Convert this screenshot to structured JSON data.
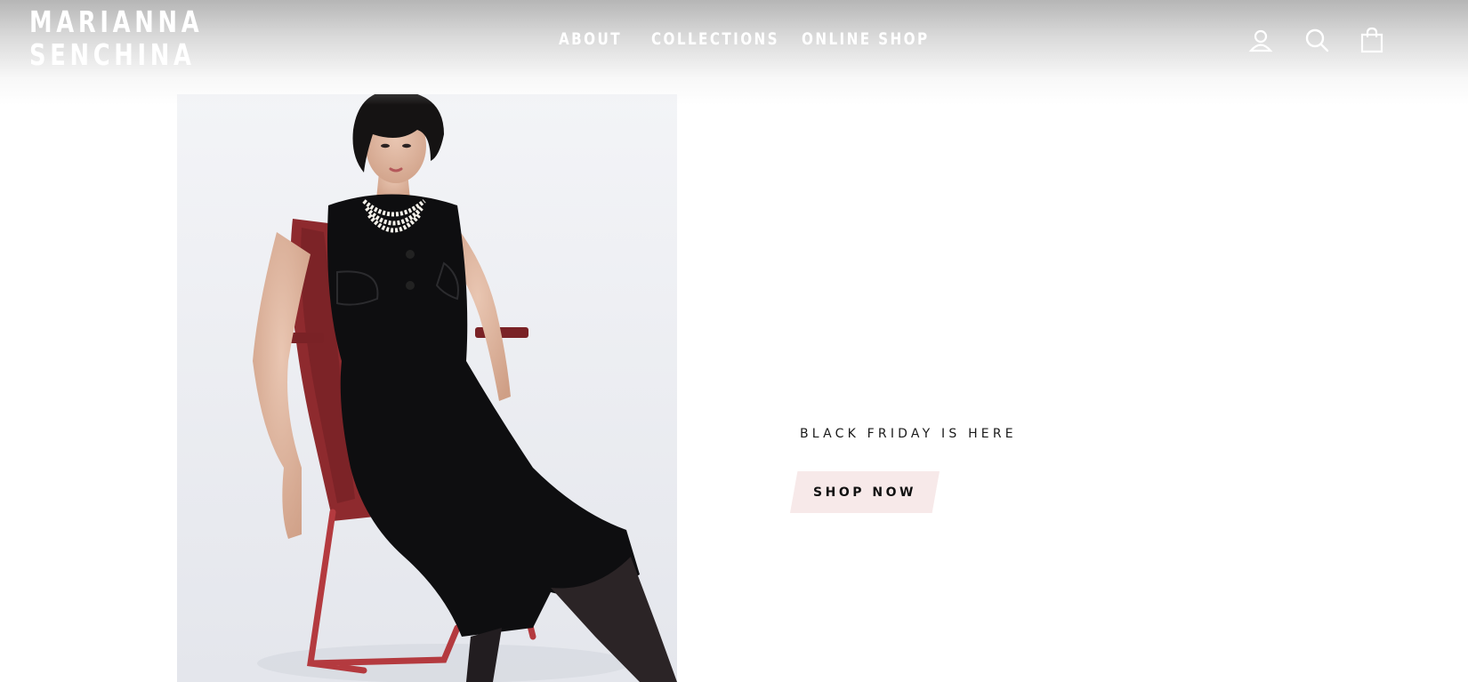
{
  "header": {
    "logo_line1": "MARIANNA",
    "logo_line2": "SENCHINA",
    "nav": {
      "about": "ABOUT",
      "collections": "COLLECTIONS",
      "online_shop": "ONLINE SHOP"
    },
    "icons": [
      "account-icon",
      "search-icon",
      "cart-icon"
    ]
  },
  "hero": {
    "image_alt": "Model in black sleeveless velvet dress with pearl necklace seated on a red chair",
    "heading": "BLACK FRIDAY IS HERE",
    "cta_label": "SHOP NOW"
  },
  "colors": {
    "cta_background": "#f7e9e9",
    "header_text": "#ffffff",
    "body_text": "#1a1a1a"
  }
}
